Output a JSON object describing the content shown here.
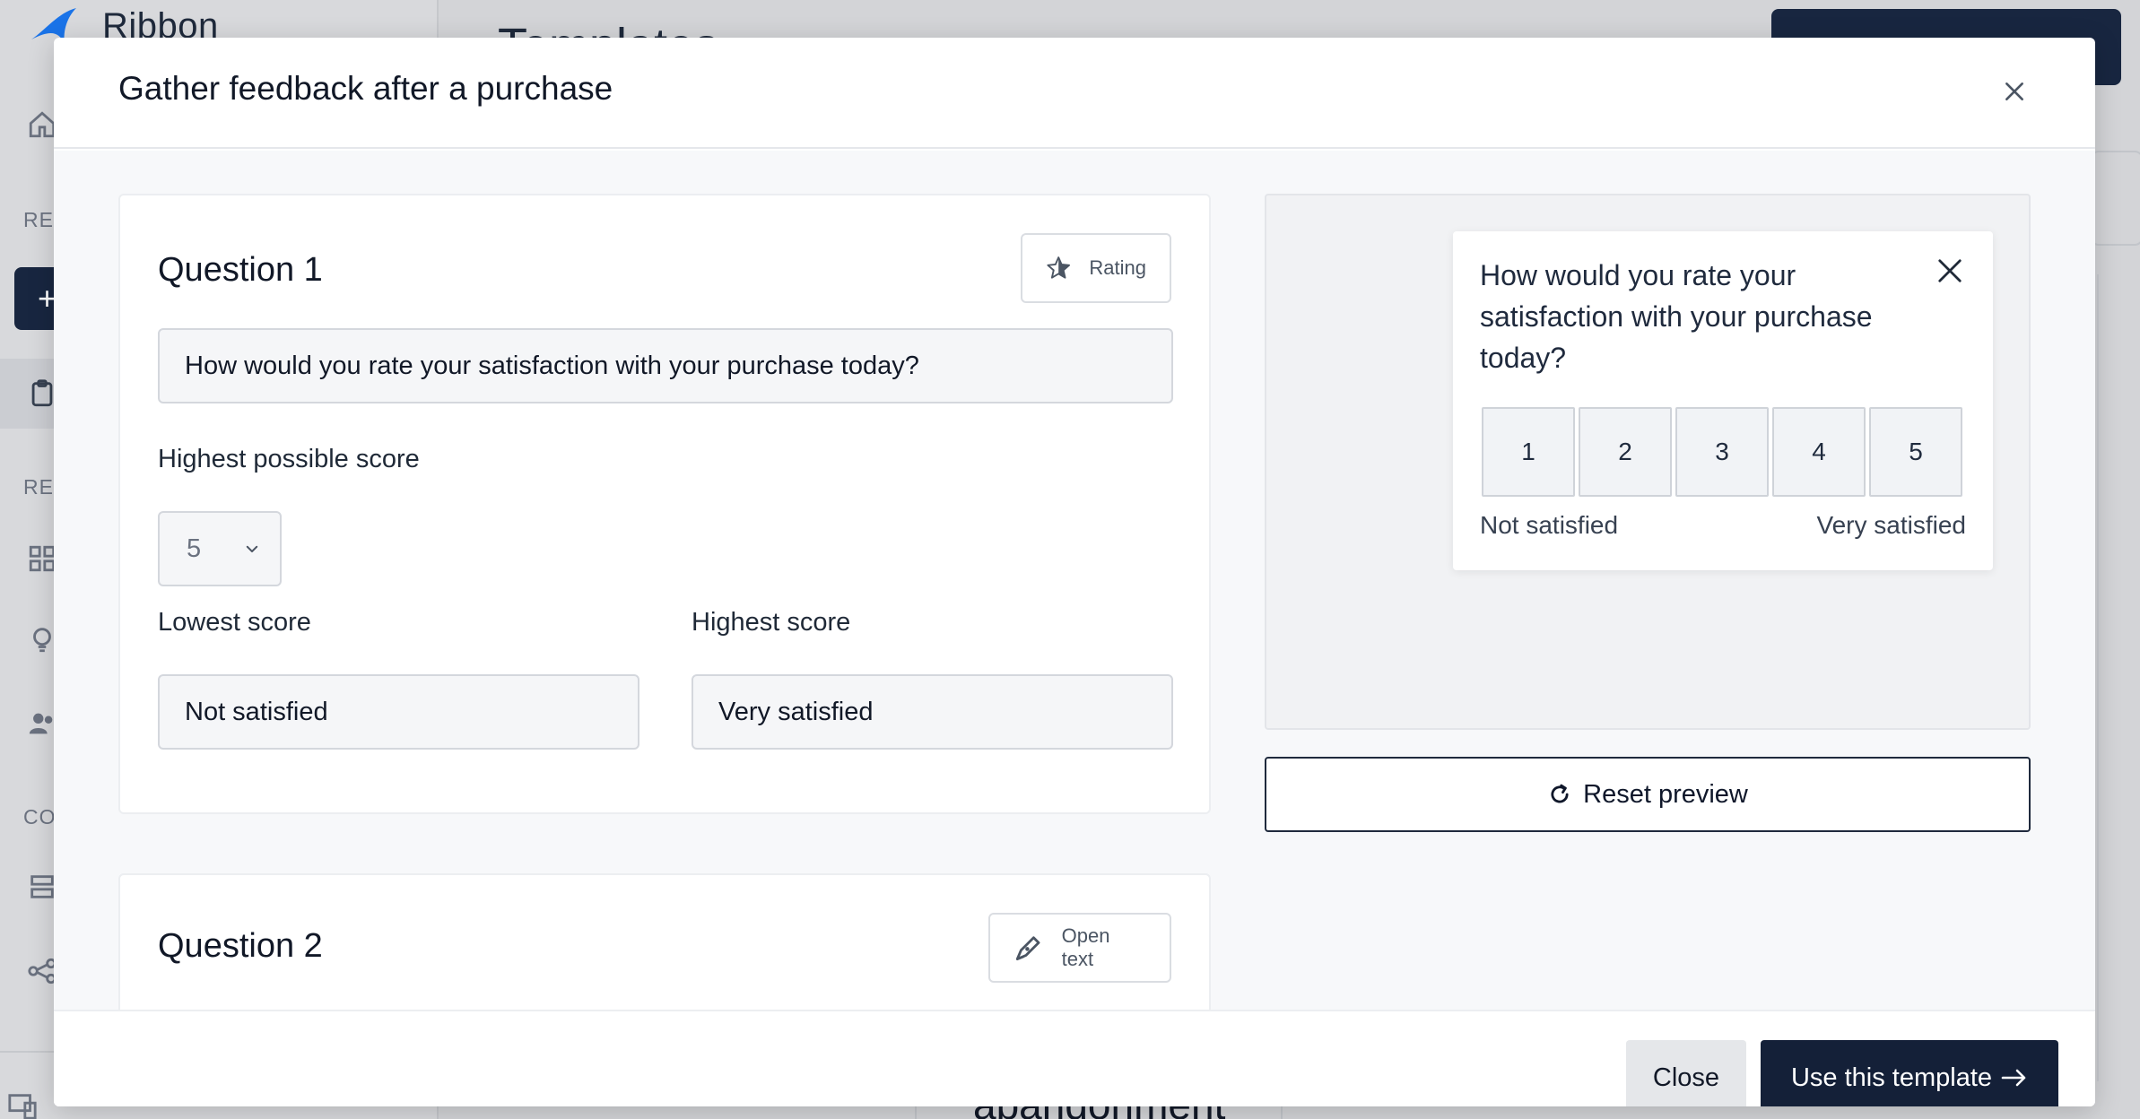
{
  "background": {
    "brand": "Ribbon",
    "sections": [
      "RES",
      "REI",
      "CO"
    ],
    "main_title": "Templates",
    "card_text": "abandonment"
  },
  "modal": {
    "title": "Gather feedback after a purchase",
    "question1": {
      "title": "Question 1",
      "type_label": "Rating",
      "question_text": "How would you rate your satisfaction with your purchase today?",
      "highest_possible_label": "Highest possible score",
      "highest_possible_value": "5",
      "lowest_label": "Lowest score",
      "lowest_value": "Not satisfied",
      "highest_label": "Highest score",
      "highest_value": "Very satisfied"
    },
    "question2": {
      "title": "Question 2",
      "type_label": "Open text"
    },
    "preview": {
      "question": "How would you rate your satisfaction with your purchase today?",
      "scale": [
        "1",
        "2",
        "3",
        "4",
        "5"
      ],
      "low_label": "Not satisfied",
      "high_label": "Very satisfied",
      "reset_label": "Reset preview"
    },
    "footer": {
      "close_label": "Close",
      "use_label": "Use this template"
    }
  },
  "colors": {
    "primary": "#142038",
    "brand_blue": "#1a73e8"
  }
}
